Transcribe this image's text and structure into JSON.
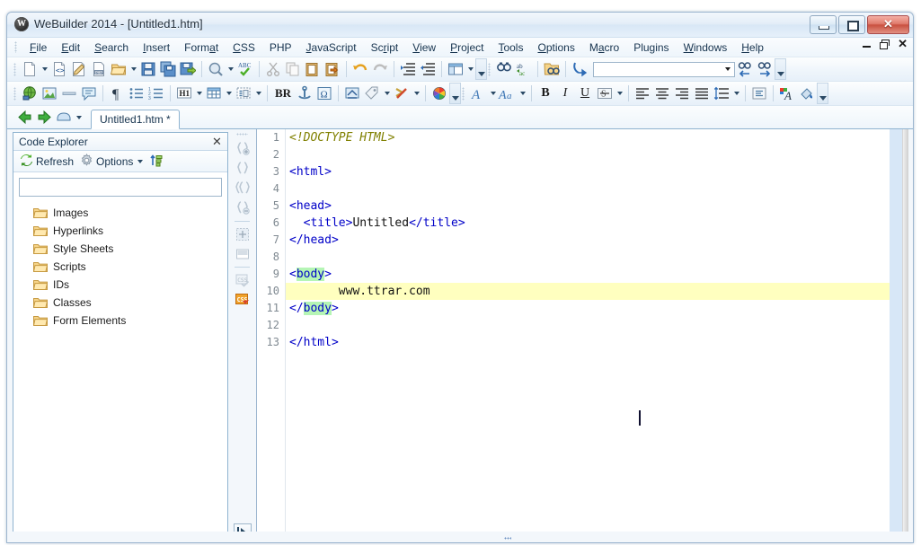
{
  "window": {
    "title": "WeBuilder 2014 - [Untitled1.htm]",
    "logo_letter": "W",
    "controls": {
      "minimize": "minimize-button",
      "maximize": "maximize-button",
      "close": "close-button",
      "close_glyph": "✕"
    },
    "mdi_controls": {
      "minimize": "mdi-minimize",
      "restore": "mdi-restore",
      "close": "✕"
    }
  },
  "menubar": {
    "items": [
      {
        "label": "File",
        "accel": "F"
      },
      {
        "label": "Edit",
        "accel": "E"
      },
      {
        "label": "Search",
        "accel": "S"
      },
      {
        "label": "Insert",
        "accel": "I"
      },
      {
        "label": "Format",
        "accel": "a"
      },
      {
        "label": "CSS",
        "accel": "C"
      },
      {
        "label": "PHP",
        "accel": ""
      },
      {
        "label": "JavaScript",
        "accel": "J"
      },
      {
        "label": "Script",
        "accel": "r"
      },
      {
        "label": "View",
        "accel": "V"
      },
      {
        "label": "Project",
        "accel": "P"
      },
      {
        "label": "Tools",
        "accel": "T"
      },
      {
        "label": "Options",
        "accel": "O"
      },
      {
        "label": "Macro",
        "accel": "a"
      },
      {
        "label": "Plugins",
        "accel": ""
      },
      {
        "label": "Windows",
        "accel": "W"
      },
      {
        "label": "Help",
        "accel": "H"
      }
    ]
  },
  "toolbar_top": {
    "search_value": "",
    "search_placeholder": "",
    "buttons": [
      "new-file-icon",
      "new-file-dropdown",
      "new-php-file-icon",
      "new-edit-file-icon",
      "php-file-icon",
      "open-folder-icon",
      "open-dropdown",
      "save-icon",
      "save-all-icon",
      "save-as-icon",
      "preview-icon",
      "preview-dropdown",
      "spellcheck-icon",
      "cut-icon",
      "copy-icon",
      "paste-icon",
      "paste-special-icon",
      "undo-icon",
      "redo-icon",
      "indent-icon",
      "outdent-icon",
      "layout-icon",
      "layout-dropdown",
      "overflow-icon",
      "find-icon",
      "replace-icon",
      "find-in-files-icon",
      "goto-icon",
      "find-prev-icon",
      "find-next-icon",
      "overflow-icon-2"
    ]
  },
  "toolbar_second": {
    "buttons": [
      "hyperlink-icon",
      "image-icon",
      "horizontal-rule-icon",
      "comment-icon",
      "paragraph-icon",
      "unordered-list-icon",
      "ordered-list-icon",
      "heading-icon",
      "heading-dropdown",
      "table-icon",
      "table-dropdown",
      "form-icon",
      "form-dropdown",
      "line-break-label",
      "anchor-icon",
      "special-char-icon",
      "meta-icon",
      "tag-icon",
      "tag-dropdown",
      "script-icon",
      "script-dropdown",
      "color-picker-icon",
      "overflow-icon",
      "font-icon",
      "font-dropdown",
      "font-style-icon",
      "font-style-dropdown",
      "bold-icon",
      "italic-icon",
      "underline-icon",
      "strikethrough-icon",
      "strikethrough-dropdown",
      "align-left-icon",
      "align-center-icon",
      "align-right-icon",
      "align-justify-icon",
      "line-spacing-icon",
      "line-spacing-dropdown",
      "indent-block-icon",
      "text-color-icon",
      "highlight-color-icon",
      "overflow-icon-2"
    ],
    "br_label": "BR",
    "bold_label": "B",
    "italic_label": "I",
    "underline_label": "U",
    "strike_label": "S"
  },
  "tabstrip": {
    "back_icon": "back-arrow-icon",
    "forward_icon": "forward-arrow-icon",
    "dropdown_icon": "window-list-icon",
    "tabs": [
      {
        "label": "Untitled1.htm *",
        "active": true
      }
    ]
  },
  "explorer": {
    "title": "Code Explorer",
    "close_glyph": "✕",
    "tools": [
      {
        "label": "Refresh",
        "icon": "refresh-icon",
        "dropdown": false
      },
      {
        "label": "Options",
        "icon": "gear-icon",
        "dropdown": true
      },
      {
        "label": "",
        "icon": "sort-icon",
        "dropdown": false
      }
    ],
    "search_value": "",
    "search_placeholder": "",
    "tree": [
      {
        "label": "Images",
        "icon": "folder-icon"
      },
      {
        "label": "Hyperlinks",
        "icon": "folder-icon"
      },
      {
        "label": "Style Sheets",
        "icon": "folder-icon"
      },
      {
        "label": "Scripts",
        "icon": "folder-icon"
      },
      {
        "label": "IDs",
        "icon": "folder-icon"
      },
      {
        "label": "Classes",
        "icon": "folder-icon"
      },
      {
        "label": "Form Elements",
        "icon": "folder-icon"
      }
    ]
  },
  "vtoolbar": {
    "buttons": [
      "code-snippet-add-icon",
      "code-snippet-icon",
      "code-snippet-double-icon",
      "code-snippet-remove-icon",
      "code-format-icon",
      "code-block-icon",
      "css-snippet-icon",
      "css-active-icon"
    ],
    "expand_icon": "expand-panel-icon"
  },
  "editor": {
    "line_numbers": [
      "1",
      "2",
      "3",
      "4",
      "5",
      "6",
      "7",
      "8",
      "9",
      "10",
      "11",
      "12",
      "13"
    ],
    "highlight_line": 10,
    "lines": [
      {
        "n": 1,
        "tokens": [
          {
            "t": "<!DOCTYPE HTML>",
            "c": "doctype"
          }
        ]
      },
      {
        "n": 2,
        "tokens": []
      },
      {
        "n": 3,
        "tokens": [
          {
            "t": "<html>",
            "c": "tag"
          }
        ]
      },
      {
        "n": 4,
        "tokens": []
      },
      {
        "n": 5,
        "tokens": [
          {
            "t": "<head>",
            "c": "tag"
          }
        ]
      },
      {
        "n": 6,
        "tokens": [
          {
            "t": "  <title>",
            "c": "tag"
          },
          {
            "t": "Untitled",
            "c": "txt"
          },
          {
            "t": "</title>",
            "c": "tag"
          }
        ]
      },
      {
        "n": 7,
        "tokens": [
          {
            "t": "</head>",
            "c": "tag"
          }
        ]
      },
      {
        "n": 8,
        "tokens": []
      },
      {
        "n": 9,
        "tokens": [
          {
            "t": "<",
            "c": "tag"
          },
          {
            "t": "body",
            "c": "brmatch"
          },
          {
            "t": ">",
            "c": "tag"
          }
        ]
      },
      {
        "n": 10,
        "tokens": [
          {
            "t": "       www.ttrar.com",
            "c": "txt"
          }
        ]
      },
      {
        "n": 11,
        "tokens": [
          {
            "t": "</",
            "c": "tag"
          },
          {
            "t": "body",
            "c": "brmatch"
          },
          {
            "t": ">",
            "c": "tag"
          }
        ]
      },
      {
        "n": 12,
        "tokens": []
      },
      {
        "n": 13,
        "tokens": [
          {
            "t": "</html>",
            "c": "tag"
          }
        ]
      }
    ],
    "caret_line": 10,
    "error_marker": "error-marker-icon"
  },
  "colors": {
    "tag": "#0000c8",
    "doctype": "#808000",
    "highlight_line_bg": "#ffffbf",
    "bracket_match_bg": "#b5f5b5",
    "right_margin": "#d7e7f7",
    "frame_border": "#9cb6cf"
  }
}
